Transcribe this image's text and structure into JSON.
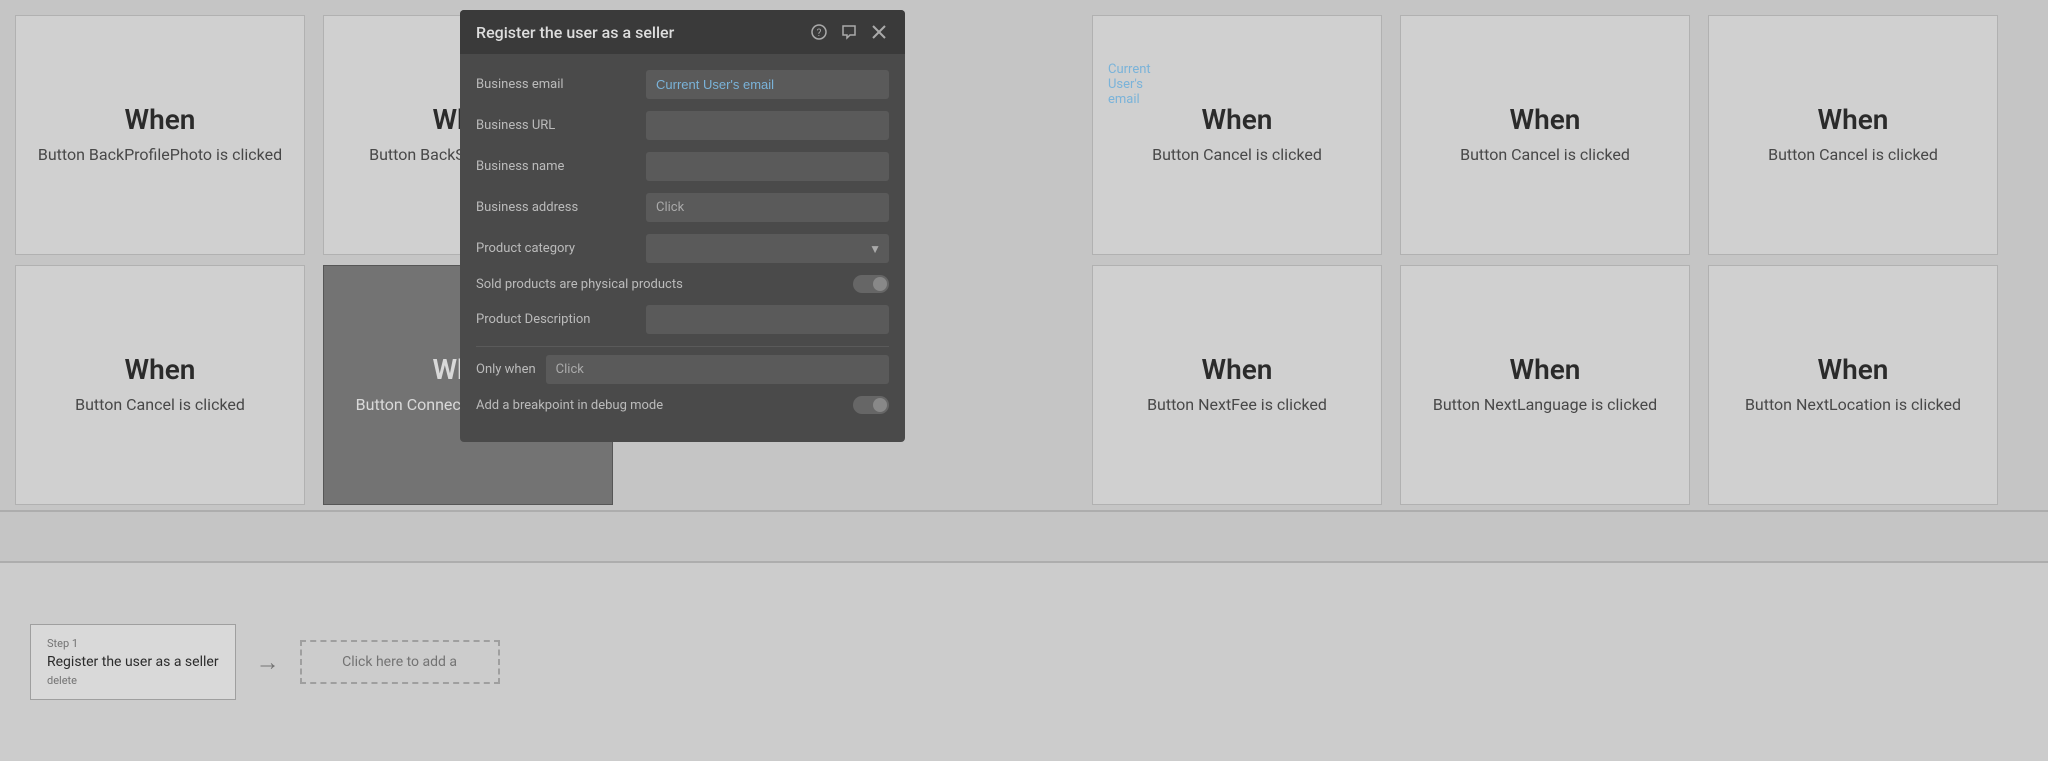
{
  "modal": {
    "title": "Register the user as a seller",
    "fields": {
      "business_email_label": "Business email",
      "business_email_value": "Current User's email",
      "business_url_label": "Business URL",
      "business_url_value": "",
      "business_name_label": "Business name",
      "business_name_value": "",
      "business_address_label": "Business address",
      "business_address_value": "Click",
      "product_category_label": "Product category",
      "product_category_value": "",
      "sold_products_label": "Sold products are physical products",
      "product_description_label": "Product Description",
      "product_description_value": "",
      "only_when_label": "Only when",
      "only_when_value": "Click",
      "breakpoint_label": "Add a breakpoint in debug mode"
    },
    "icons": {
      "help": "?",
      "comment": "💬",
      "close": "✕"
    }
  },
  "cards": {
    "row1": [
      {
        "id": "card-backprofilephoto",
        "when": "When",
        "event": "Button BackProfilePhoto is clicked",
        "active": false
      },
      {
        "id": "card-backstripe",
        "when": "When",
        "event": "Button BackStripe is clicked",
        "active": false
      },
      {
        "id": "card-empty1",
        "when": "",
        "event": "",
        "active": false,
        "hidden": true
      },
      {
        "id": "card-cancel1",
        "when": "When",
        "event": "Button Cancel is clicked",
        "active": false
      },
      {
        "id": "card-cancel2",
        "when": "When",
        "event": "Button Cancel is clicked",
        "active": false
      },
      {
        "id": "card-cancel3",
        "when": "When",
        "event": "Button Cancel is clicked",
        "active": false
      }
    ],
    "row2": [
      {
        "id": "card-cancel4",
        "when": "When",
        "event": "Button Cancel is clicked",
        "active": false
      },
      {
        "id": "card-connectstripe",
        "when": "When",
        "event": "Button Connect stripe is clicked",
        "active": true
      },
      {
        "id": "card-empty2",
        "when": "",
        "event": "",
        "active": false,
        "hidden": true
      },
      {
        "id": "card-nextfee",
        "when": "When",
        "event": "Button NextFee is clicked",
        "active": false
      },
      {
        "id": "card-nextlanguage",
        "when": "When",
        "event": "Button NextLanguage is clicked",
        "active": false
      },
      {
        "id": "card-nextlocation",
        "when": "When",
        "event": "Button NextLocation is clicked",
        "active": false
      }
    ]
  },
  "workflow": {
    "step1": {
      "number": "Step 1",
      "name": "Register the user as a seller",
      "delete_label": "delete"
    },
    "add_step_label": "Click here to add a",
    "arrow": "→"
  }
}
